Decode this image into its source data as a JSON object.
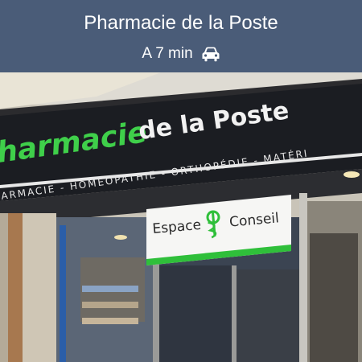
{
  "header": {
    "title": "Pharmacie de la Poste",
    "travel_time": "A 7 min",
    "travel_icon": "car-icon",
    "background_color": "#4a5c78"
  },
  "photo": {
    "sign": {
      "main_left": "harmacie",
      "main_right": "de la Poste",
      "services": "ARMACIE - HOMÉOPATHIE - ORTHOPÉDIE - MATÉRI",
      "panel_left": "Espace",
      "panel_right": "Conseil"
    }
  }
}
